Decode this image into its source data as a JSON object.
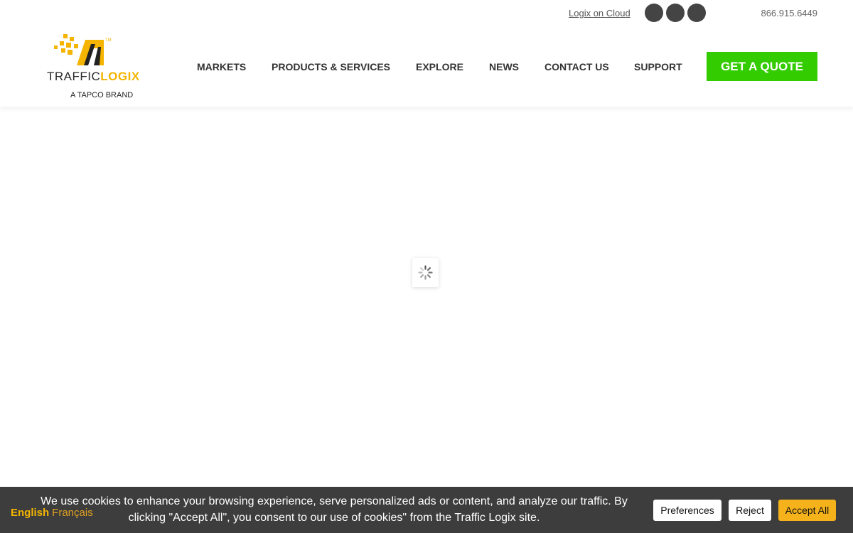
{
  "topbar": {
    "cloud_link": "Logix on Cloud",
    "phone": "866.915.6449",
    "social_icons": [
      "social-icon-1",
      "social-icon-2",
      "social-icon-3"
    ]
  },
  "logo": {
    "word_light": "TRAFFIC",
    "word_bold": "LOGIX",
    "tagline": "A TAPCO BRAND",
    "colors": {
      "accent": "#f4b400",
      "dark": "#222222"
    }
  },
  "nav": {
    "items": [
      "MARKETS",
      "PRODUCTS & SERVICES",
      "EXPLORE",
      "NEWS",
      "CONTACT US",
      "SUPPORT"
    ],
    "cta": "GET A QUOTE",
    "cta_color": "#33cc00"
  },
  "cookie": {
    "lang_active": "English",
    "lang_alt": "Français",
    "text": "We use cookies to enhance your browsing experience, serve personalized ads or content, and analyze our traffic. By clicking \"Accept All\", you consent to our use of cookies\" from the Traffic Logix site.",
    "preferences": "Preferences",
    "reject": "Reject",
    "accept": "Accept All",
    "accept_color": "#f5b21b"
  }
}
